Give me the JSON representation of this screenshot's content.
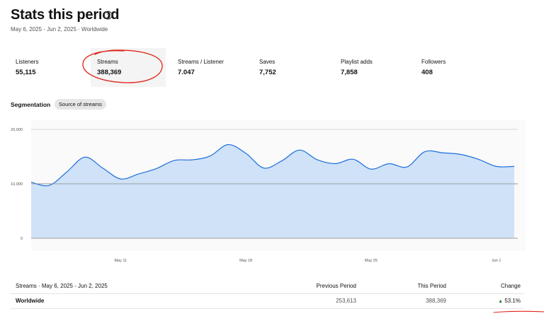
{
  "header": {
    "title": "Stats this period",
    "subtitle": "May 6, 2025 - Jun 2, 2025 · Worldwide"
  },
  "metrics": [
    {
      "label": "Listeners",
      "value": "55,115"
    },
    {
      "label": "Streams",
      "value": "388,369"
    },
    {
      "label": "Streams / Listener",
      "value": "7.047"
    },
    {
      "label": "Saves",
      "value": "7,752"
    },
    {
      "label": "Playlist adds",
      "value": "7,858"
    },
    {
      "label": "Followers",
      "value": "408"
    }
  ],
  "segmentation": {
    "label": "Segmentation",
    "chip": "Source of streams"
  },
  "chart_data": {
    "type": "area",
    "y_ticks": [
      "20,000",
      "10,000",
      "0"
    ],
    "ylim": [
      0,
      20000
    ],
    "x_ticks": [
      "May 11",
      "May 18",
      "May 25",
      "Jun 1"
    ],
    "categories": [
      "May 6",
      "May 7",
      "May 8",
      "May 9",
      "May 10",
      "May 11",
      "May 12",
      "May 13",
      "May 14",
      "May 15",
      "May 16",
      "May 17",
      "May 18",
      "May 19",
      "May 20",
      "May 21",
      "May 22",
      "May 23",
      "May 24",
      "May 25",
      "May 26",
      "May 27",
      "May 28",
      "May 29",
      "May 30",
      "May 31",
      "Jun 1",
      "Jun 2"
    ],
    "values": [
      10300,
      9700,
      12200,
      14900,
      12900,
      10900,
      11800,
      12800,
      14300,
      14400,
      15100,
      17200,
      15600,
      12900,
      14200,
      16200,
      14400,
      13700,
      14500,
      12700,
      13700,
      13100,
      15900,
      15700,
      15400,
      14500,
      13200,
      13200
    ],
    "color": "#cfe2f8",
    "line_color": "#1e6fd9",
    "grid": true
  },
  "table": {
    "header": {
      "title": "Streams · May 6, 2025 - Jun 2, 2025",
      "previous": "Previous Period",
      "current": "This Period",
      "change": "Change"
    },
    "rows": [
      {
        "name": "Worldwide",
        "previous": "253,613",
        "current": "388,369",
        "change": "53.1%"
      }
    ],
    "up_color": "#1a7f37"
  }
}
